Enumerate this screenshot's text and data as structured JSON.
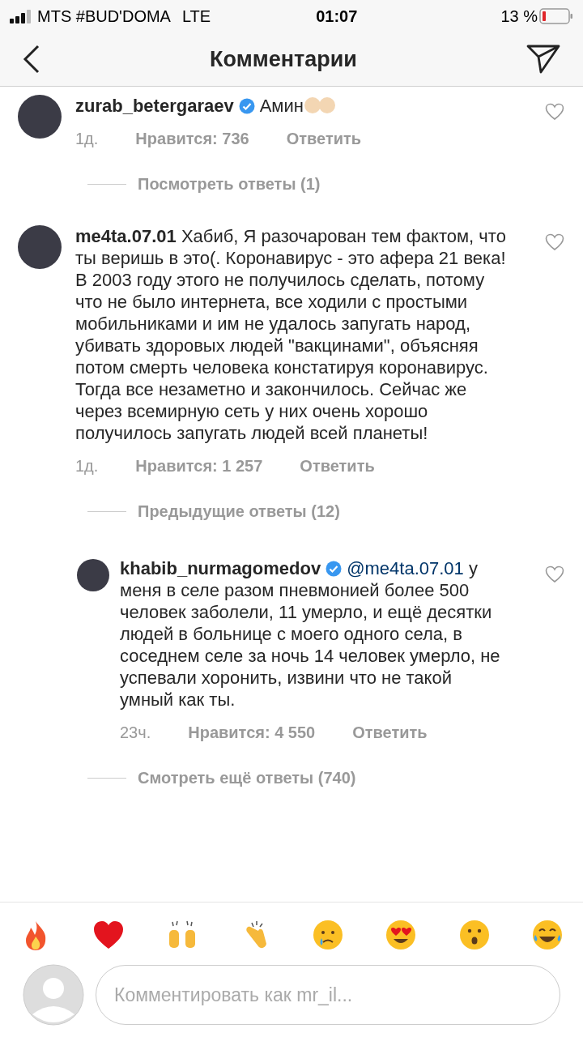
{
  "status_bar": {
    "carrier": "MTS #BUD'DOMA",
    "network": "LTE",
    "time": "01:07",
    "battery": "13 %"
  },
  "header": {
    "title": "Комментарии"
  },
  "items": [
    {
      "kind": "comment",
      "reply": false,
      "username": "zurab_betergaraev",
      "verified": true,
      "text": "Амин",
      "text_emoji": true,
      "time": "1д.",
      "likes": "Нравится: 736",
      "reply_label": "Ответить",
      "liked": false
    },
    {
      "kind": "link",
      "label": "Посмотреть ответы (1)"
    },
    {
      "kind": "comment",
      "reply": false,
      "username": "me4ta.07.01",
      "verified": false,
      "text": "Хабиб, Я разочарован тем фактом, что ты веришь в это(. Коронавирус - это афера 21 века! В 2003 году этого не получилось сделать, потому что не было интернета, все ходили с простыми мобильниками и им не удалось запугать народ, убивать здоровых людей \"вакцинами\", объясняя потом смерть человека констатируя коронавирус. Тогда все незаметно и закончилось. Сейчас же через всемирную сеть у них очень хорошо получилось запугать людей всей планеты!",
      "time": "1д.",
      "likes": "Нравится: 1 257",
      "reply_label": "Ответить",
      "liked": false
    },
    {
      "kind": "link",
      "label": "Предыдущие ответы (12)"
    },
    {
      "kind": "comment",
      "reply": true,
      "username": "khabib_nurmagomedov",
      "verified": true,
      "mention": "@me4ta.07.01",
      "text": "у меня в селе разом пневмонией более 500 человек заболели, 11 умерло, и ещё десятки людей в больнице с моего одного села, в соседнем селе за ночь 14 человек умерло, не успевали хоронить, извини что не такой умный как ты.",
      "time": "23ч.",
      "likes": "Нравится: 4 550",
      "reply_label": "Ответить",
      "liked": false
    },
    {
      "kind": "link",
      "label": "Смотреть ещё ответы (740)"
    }
  ],
  "composer": {
    "placeholder": "Комментировать как mr_il..."
  }
}
